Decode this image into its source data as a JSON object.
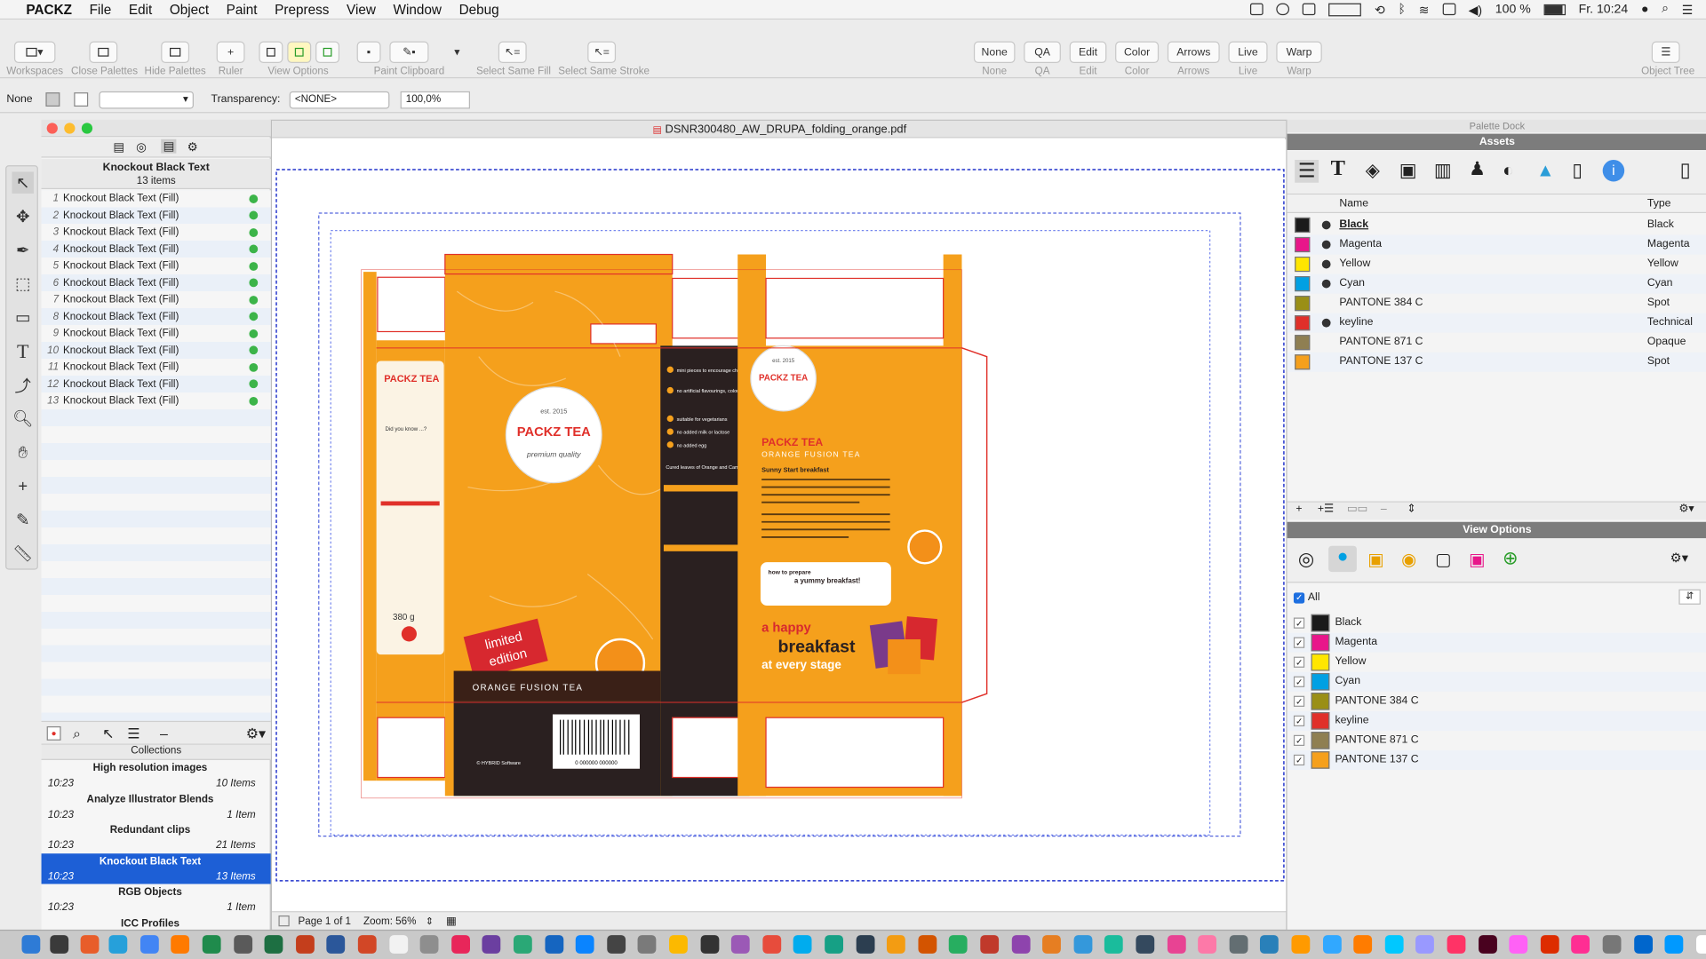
{
  "menubar": {
    "apple": "",
    "app": "PACKZ",
    "items": [
      "File",
      "Edit",
      "Object",
      "Paint",
      "Prepress",
      "View",
      "Window",
      "Debug"
    ],
    "battery": "100 %",
    "clock": "Fr. 10:24"
  },
  "toolbar": {
    "workspaces": "Workspaces",
    "close_palettes": "Close Palettes",
    "hide_palettes": "Hide Palettes",
    "ruler": "Ruler",
    "view_options": "View Options",
    "paint_clipboard": "Paint Clipboard",
    "select_same_fill": "Select Same Fill",
    "select_same_stroke": "Select Same Stroke",
    "mode_buttons": [
      "None",
      "QA",
      "Edit",
      "Color",
      "Arrows",
      "Live",
      "Warp"
    ],
    "object_tree": "Object Tree"
  },
  "optionsbar": {
    "fill_label": "None",
    "transparency_label": "Transparency:",
    "transparency_value": "<NONE>",
    "opacity_value": "100,0%"
  },
  "leftpanel": {
    "title": "Knockout Black Text",
    "count": "13 items",
    "items": [
      {
        "n": "1",
        "label": "Knockout Black Text (Fill)"
      },
      {
        "n": "2",
        "label": "Knockout Black Text (Fill)"
      },
      {
        "n": "3",
        "label": "Knockout Black Text (Fill)"
      },
      {
        "n": "4",
        "label": "Knockout Black Text (Fill)"
      },
      {
        "n": "5",
        "label": "Knockout Black Text (Fill)"
      },
      {
        "n": "6",
        "label": "Knockout Black Text (Fill)"
      },
      {
        "n": "7",
        "label": "Knockout Black Text (Fill)"
      },
      {
        "n": "8",
        "label": "Knockout Black Text (Fill)"
      },
      {
        "n": "9",
        "label": "Knockout Black Text (Fill)"
      },
      {
        "n": "10",
        "label": "Knockout Black Text (Fill)"
      },
      {
        "n": "11",
        "label": "Knockout Black Text (Fill)"
      },
      {
        "n": "12",
        "label": "Knockout Black Text (Fill)"
      },
      {
        "n": "13",
        "label": "Knockout Black Text (Fill)"
      }
    ],
    "collections_label": "Collections",
    "collections": [
      {
        "name": "High resolution images",
        "time": "10:23",
        "count": "10 Items"
      },
      {
        "name": "Analyze Illustrator Blends",
        "time": "10:23",
        "count": "1 Item"
      },
      {
        "name": "Redundant clips",
        "time": "10:23",
        "count": "21 Items"
      },
      {
        "name": "Knockout Black Text",
        "time": "10:23",
        "count": "13 Items"
      },
      {
        "name": "RGB Objects",
        "time": "10:23",
        "count": "1 Item"
      },
      {
        "name": "ICC Profiles",
        "time": "",
        "count": ""
      }
    ]
  },
  "document": {
    "filename": "DSNR300480_AW_DRUPA_folding_orange.pdf",
    "page": "Page 1 of 1",
    "zoom": "Zoom: 56%",
    "artwork": {
      "brand": "PACKZ TEA",
      "est": "est. 2015",
      "quality": "premium quality",
      "limited": "limited",
      "edition": "edition",
      "product": "ORANGE FUSION TEA",
      "product_small": "ORANGE FUSION TEA",
      "sunny": "Sunny Start breakfast",
      "how": "how to prepare",
      "yummy": "a yummy breakfast!",
      "happy": "a happy",
      "breakfast": "breakfast",
      "stage": "at every stage",
      "did_you_know": "Did you know ...?",
      "weight": "380 g",
      "barcode_num": "0 000000 000000",
      "hybrid": "© HYBRID Software",
      "features": [
        "mini pieces to encourage chewing",
        "no artificial flavourings, colourings or preservatives",
        "suitable for vegetarians",
        "no added milk or lactose",
        "no added egg"
      ],
      "cured": "Cured leaves of Orange and Camillia"
    }
  },
  "rightdock": {
    "dock_title": "Palette Dock",
    "assets_title": "Assets",
    "col_name": "Name",
    "col_type": "Type",
    "assets": [
      {
        "name": "Black",
        "type": "Black",
        "color": "#1a1a1a"
      },
      {
        "name": "Magenta",
        "type": "Magenta",
        "color": "#e8168a"
      },
      {
        "name": "Yellow",
        "type": "Yellow",
        "color": "#ffe600"
      },
      {
        "name": "Cyan",
        "type": "Cyan",
        "color": "#00a0e3"
      },
      {
        "name": "PANTONE 384 C",
        "type": "Spot",
        "color": "#9a8f16"
      },
      {
        "name": "keyline",
        "type": "Technical",
        "color": "#e0302a"
      },
      {
        "name": "PANTONE 871 C",
        "type": "Opaque",
        "color": "#8f7f52"
      },
      {
        "name": "PANTONE 137 C",
        "type": "Spot",
        "color": "#f5a01c"
      }
    ],
    "viewoptions_title": "View Options",
    "all_label": "All",
    "separations": [
      {
        "name": "Black",
        "color": "#1a1a1a"
      },
      {
        "name": "Magenta",
        "color": "#e8168a"
      },
      {
        "name": "Yellow",
        "color": "#ffe600"
      },
      {
        "name": "Cyan",
        "color": "#00a0e3"
      },
      {
        "name": "PANTONE 384 C",
        "color": "#9a8f16"
      },
      {
        "name": "keyline",
        "color": "#e0302a"
      },
      {
        "name": "PANTONE 871 C",
        "color": "#8f7f52"
      },
      {
        "name": "PANTONE 137 C",
        "color": "#f5a01c"
      }
    ]
  },
  "colors": {
    "accent": "#1d5fd6",
    "orange": "#f5a01c",
    "keyline": "#e0302a"
  }
}
